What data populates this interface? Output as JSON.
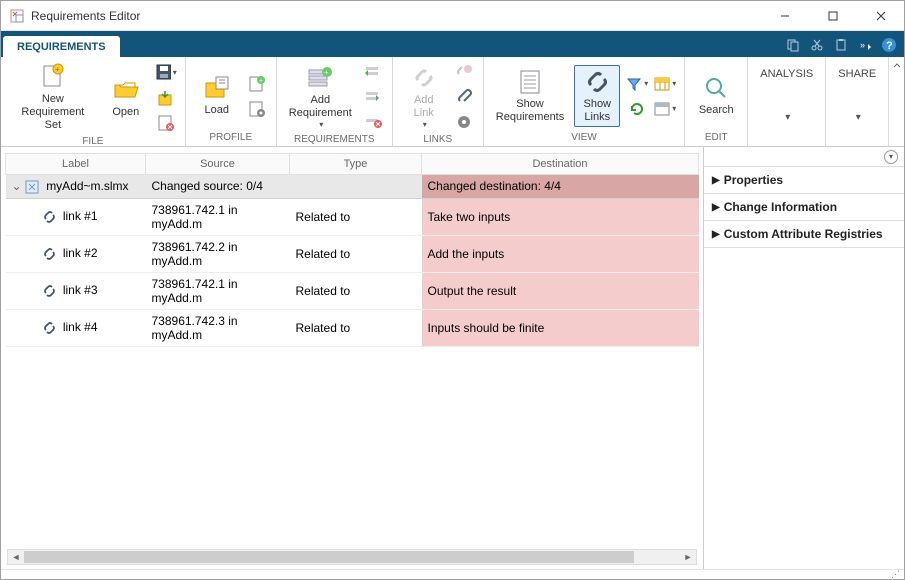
{
  "window": {
    "title": "Requirements Editor"
  },
  "tab": {
    "requirements": "REQUIREMENTS"
  },
  "toolbar": {
    "new_req_set": "New\nRequirement Set",
    "open": "Open",
    "load": "Load",
    "add_req": "Add\nRequirement",
    "add_link": "Add\nLink",
    "show_req": "Show\nRequirements",
    "show_links": "Show\nLinks",
    "search": "Search",
    "analysis": "ANALYSIS",
    "share": "SHARE",
    "groups": {
      "file": "FILE",
      "profile": "PROFILE",
      "requirements": "REQUIREMENTS",
      "links": "LINKS",
      "view": "VIEW",
      "edit": "EDIT"
    }
  },
  "columns": {
    "label": "Label",
    "source": "Source",
    "type": "Type",
    "destination": "Destination"
  },
  "tree": {
    "file": "myAdd~m.slmx",
    "changed_source": "Changed source: 0/4",
    "changed_dest": "Changed destination: 4/4"
  },
  "rows": [
    {
      "label": "link #1",
      "source": "738961.742.1 in myAdd.m",
      "type": "Related to",
      "destination": "Take two inputs"
    },
    {
      "label": "link #2",
      "source": "738961.742.2 in myAdd.m",
      "type": "Related to",
      "destination": "Add the inputs"
    },
    {
      "label": "link #3",
      "source": "738961.742.1 in myAdd.m",
      "type": "Related to",
      "destination": "Output the result"
    },
    {
      "label": "link #4",
      "source": "738961.742.3 in myAdd.m",
      "type": "Related to",
      "destination": "Inputs should be finite"
    }
  ],
  "panels": {
    "properties": "Properties",
    "change_info": "Change Information",
    "custom_attrs": "Custom Attribute Registries"
  }
}
